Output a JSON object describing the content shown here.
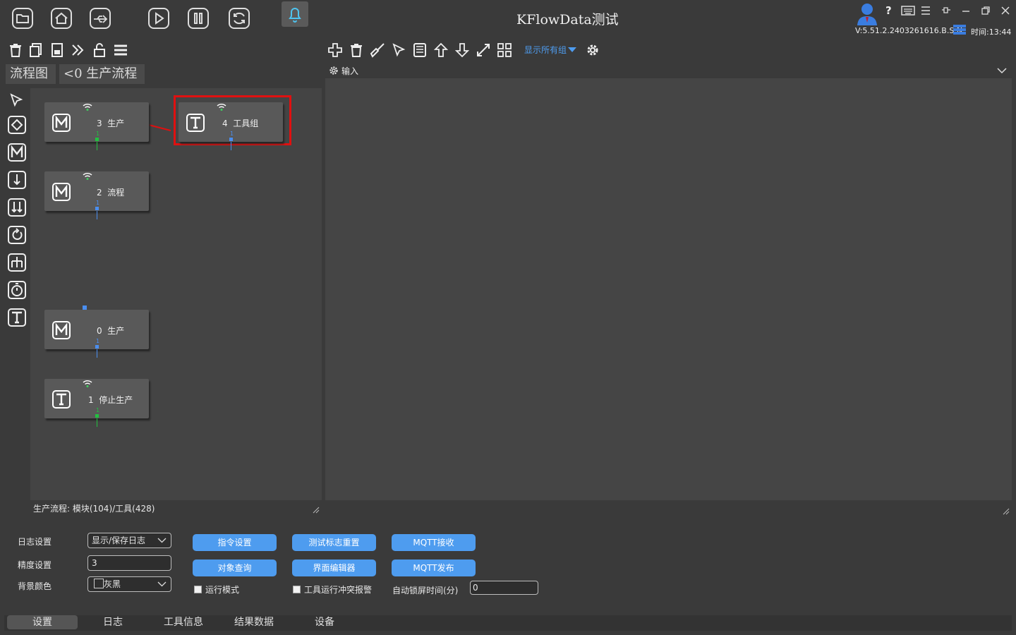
{
  "window": {
    "title": "KFlowData测试",
    "version": "V:5.51.2.2403261616.B.S.N",
    "time": "时间:13:44"
  },
  "tabs": {
    "flowchart": "流程图",
    "production_flow": "<0 生产流程"
  },
  "group_filter": "显示所有组",
  "right_panel": {
    "header_label": "输入"
  },
  "nodes": [
    {
      "icon": "M",
      "index": "3",
      "name": "生产",
      "port": "1"
    },
    {
      "icon": "T",
      "index": "4",
      "name": "工具组",
      "port": "1"
    },
    {
      "icon": "M",
      "index": "2",
      "name": "流程",
      "port": "1"
    },
    {
      "icon": "M",
      "index": "0",
      "name": "生产",
      "port": "1"
    },
    {
      "icon": "T",
      "index": "1",
      "name": "停止生产",
      "port": "1"
    }
  ],
  "canvas_status": "生产流程: 模块(104)/工具(428)",
  "settings": {
    "log_label": "日志设置",
    "log_value": "显示/保存日志",
    "precision_label": "精度设置",
    "precision_value": "3",
    "bg_label": "背景颜色",
    "bg_value": "灰黑",
    "buttons": {
      "cmd": "指令设置",
      "reset": "测试标志重置",
      "mqtt_recv": "MQTT接收",
      "obj_query": "对象查询",
      "ui_editor": "界面编辑器",
      "mqtt_pub": "MQTT发布"
    },
    "run_mode": "运行模式",
    "tool_alarm": "工具运行冲突报警",
    "lock_label": "自动锁屏时间(分)",
    "lock_value": "0"
  },
  "bottom_tabs": [
    "设置",
    "日志",
    "工具信息",
    "结果数据",
    "设备"
  ],
  "colors": {
    "accent": "#4e9cef",
    "highlight": "#e01010",
    "port_green": "#22c040",
    "port_blue": "#4a8ef0",
    "wifi_green": "#40d060"
  }
}
